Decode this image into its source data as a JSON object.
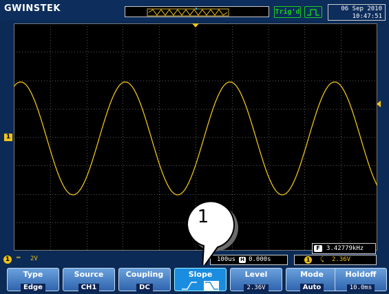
{
  "header": {
    "brand": "GWINSTEK",
    "trigger_status": "Trig'd",
    "date": "06 Sep 2010",
    "time": "10:47:51"
  },
  "channel": {
    "marker": "1",
    "coupling_symbol": "═",
    "volts_per_div": "2V"
  },
  "measurement": {
    "frequency_label": "F",
    "frequency": "3.42779kHz"
  },
  "timebase": {
    "time_per_div": "100us",
    "h_label": "H",
    "position": "0.000s"
  },
  "trigger_info": {
    "channel": "1",
    "slope_symbol": "⤹",
    "level": "2.36V"
  },
  "softkeys": [
    {
      "label": "Type",
      "value": "Edge"
    },
    {
      "label": "Source",
      "value": "CH1"
    },
    {
      "label": "Coupling",
      "value": "DC"
    },
    {
      "label": "Slope",
      "value": ""
    },
    {
      "label": "Level",
      "value": "2.36V"
    },
    {
      "label": "Mode",
      "value": "Auto"
    },
    {
      "label": "Holdoff",
      "value": "10.0ms"
    }
  ],
  "callout": {
    "number": "1"
  },
  "colors": {
    "trace": "#ecc21a",
    "background": "#0b2a55",
    "screen": "#000000",
    "trig_badge": "#18d018"
  }
}
